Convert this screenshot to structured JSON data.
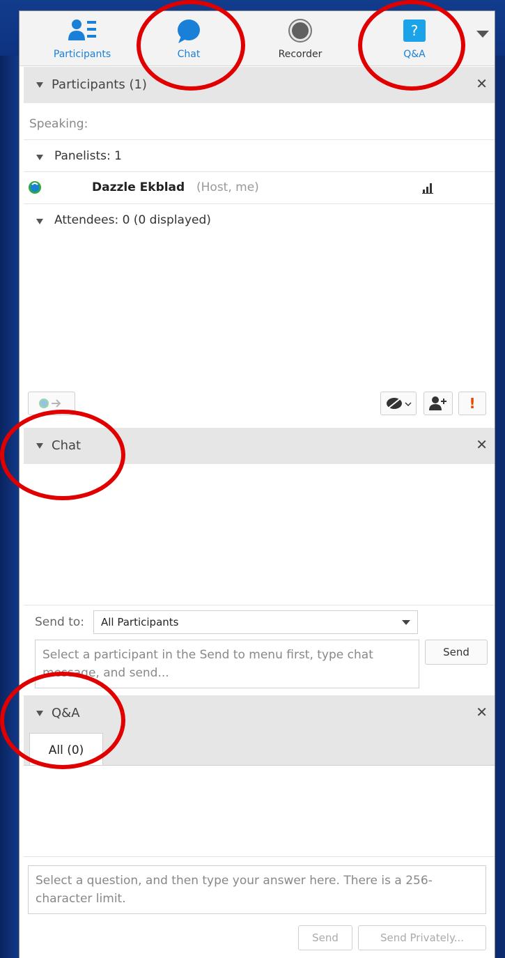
{
  "toolbar": {
    "participants_label": "Participants",
    "chat_label": "Chat",
    "recorder_label": "Recorder",
    "qa_label": "Q&A",
    "qa_icon_char": "?"
  },
  "participants": {
    "header": "Participants (1)",
    "speaking_label": "Speaking:",
    "panelists_label": "Panelists: 1",
    "user_name": "Dazzle Ekblad",
    "user_role": "(Host, me)",
    "attendees_label": "Attendees: 0 (0 displayed)"
  },
  "chat": {
    "header": "Chat",
    "send_to_label": "Send to:",
    "send_to_value": "All Participants",
    "message_placeholder": "Select a participant in the Send to menu first, type chat message, and send...",
    "send_button": "Send"
  },
  "qa": {
    "header": "Q&A",
    "tab_all": "All (0)",
    "answer_placeholder": "Select a question, and then type your answer here. There is a 256-character limit.",
    "send_button": "Send",
    "send_privately_button": "Send Privately..."
  },
  "colors": {
    "accent_blue": "#1a7fd6",
    "annotation_red": "#e00000",
    "alert_orange": "#e64a00"
  }
}
